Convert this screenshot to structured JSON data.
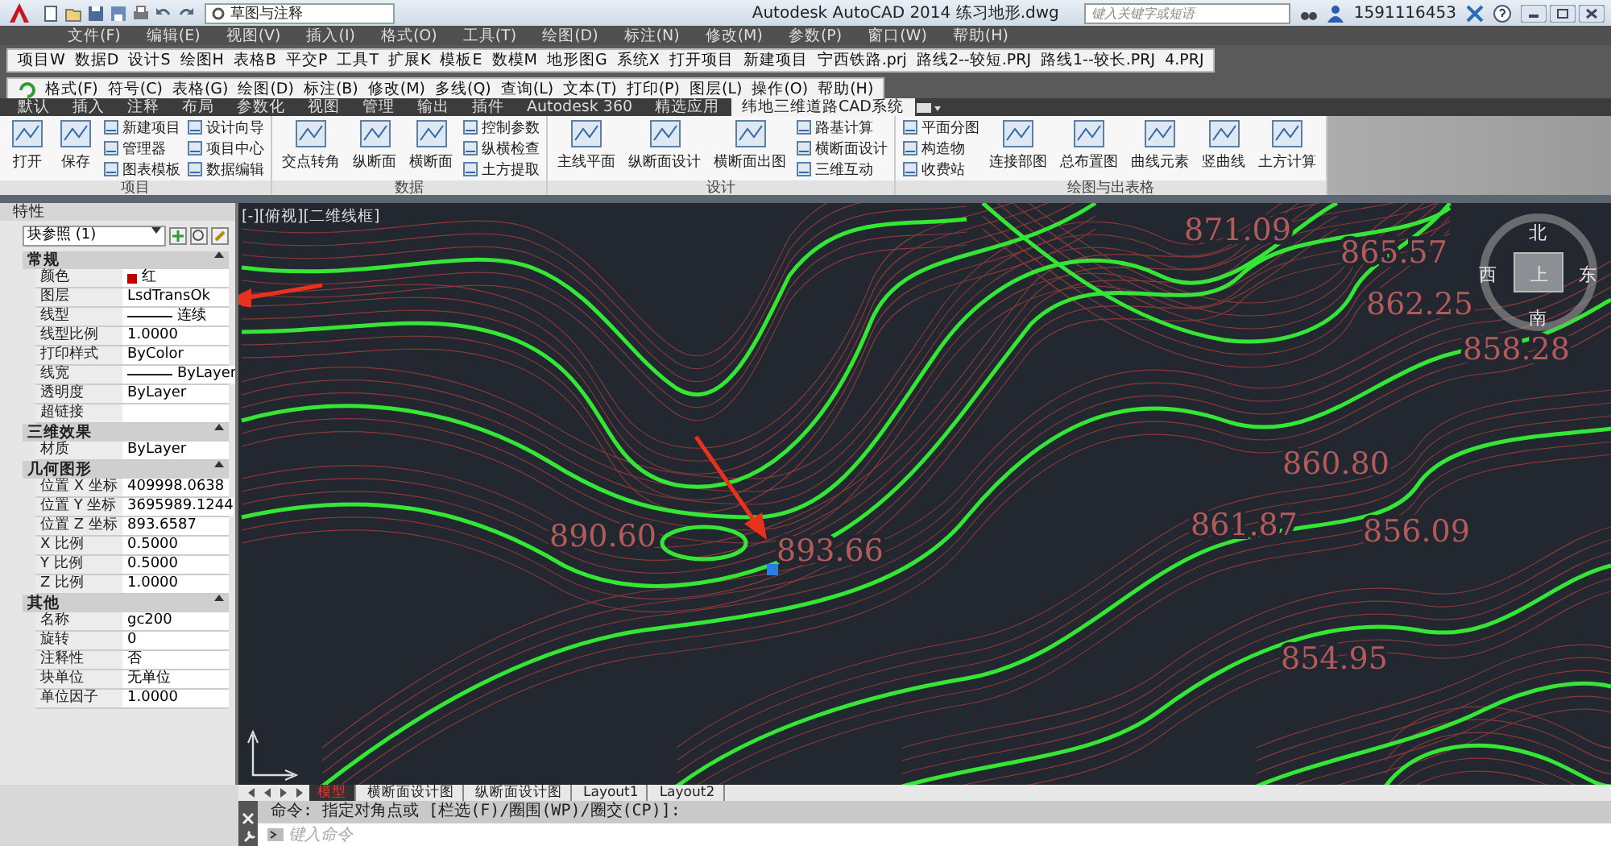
{
  "window": {
    "workspace": "草图与注释",
    "app_title": "Autodesk AutoCAD 2014",
    "file_name": "练习地形.dwg",
    "search": {
      "placeholder": "键入关键字或短语"
    },
    "user": "1591116453"
  },
  "menu_bar": [
    "文件(F)",
    "编辑(E)",
    "视图(V)",
    "插入(I)",
    "格式(O)",
    "工具(T)",
    "绘图(D)",
    "标注(N)",
    "修改(M)",
    "参数(P)",
    "窗口(W)",
    "帮助(H)"
  ],
  "toolbar_1": [
    "项目W",
    "数据D",
    "设计S",
    "绘图H",
    "表格B",
    "平交P",
    "工具T",
    "扩展K",
    "模板E",
    "数模M",
    "地形图G",
    "系统X",
    "打开项目",
    "新建项目",
    "宁西铁路.prj",
    "路线2--较短.PRJ",
    "路线1--较长.PRJ",
    "4.PRJ"
  ],
  "toolbar_2": [
    "格式(F)",
    "符号(C)",
    "表格(G)",
    "绘图(D)",
    "标注(B)",
    "修改(M)",
    "多线(Q)",
    "查询(L)",
    "文本(T)",
    "打印(P)",
    "图层(L)",
    "操作(O)",
    "帮助(H)"
  ],
  "ribbon": {
    "tabs": [
      {
        "label": "默认",
        "selected": false
      },
      {
        "label": "插入",
        "selected": false
      },
      {
        "label": "注释",
        "selected": false
      },
      {
        "label": "布局",
        "selected": false
      },
      {
        "label": "参数化",
        "selected": false
      },
      {
        "label": "视图",
        "selected": false
      },
      {
        "label": "管理",
        "selected": false
      },
      {
        "label": "输出",
        "selected": false
      },
      {
        "label": "插件",
        "selected": false
      },
      {
        "label": "Autodesk 360",
        "selected": false
      },
      {
        "label": "精选应用",
        "selected": false
      },
      {
        "label": "纬地三维道路CAD系统",
        "selected": true
      }
    ],
    "panels": [
      {
        "title": "项目",
        "tools": [
          {
            "label": "打开",
            "kind": "large"
          },
          {
            "label": "保存",
            "kind": "large"
          },
          {
            "label": "新建项目",
            "kind": "small"
          },
          {
            "label": "管理器",
            "kind": "small"
          },
          {
            "label": "图表模板",
            "kind": "small"
          },
          {
            "label": "设计向导",
            "kind": "small"
          },
          {
            "label": "项目中心",
            "kind": "small"
          },
          {
            "label": "数据编辑",
            "kind": "small"
          }
        ]
      },
      {
        "title": "数据",
        "tools": [
          {
            "label": "交点转角",
            "kind": "large"
          },
          {
            "label": "纵断面",
            "kind": "large"
          },
          {
            "label": "横断面",
            "kind": "large"
          },
          {
            "label": "控制参数",
            "kind": "small"
          },
          {
            "label": "纵横检查",
            "kind": "small"
          },
          {
            "label": "土方提取",
            "kind": "small"
          }
        ]
      },
      {
        "title": "设计",
        "tools": [
          {
            "label": "主线平面",
            "kind": "large"
          },
          {
            "label": "纵断面设计",
            "kind": "large"
          },
          {
            "label": "横断面出图",
            "kind": "large"
          },
          {
            "label": "路基计算",
            "kind": "small"
          },
          {
            "label": "横断面设计",
            "kind": "small"
          },
          {
            "label": "三维互动",
            "kind": "small"
          }
        ]
      },
      {
        "title": "绘图与出表格",
        "tools": [
          {
            "label": "平面分图",
            "kind": "small"
          },
          {
            "label": "构造物",
            "kind": "small"
          },
          {
            "label": "收费站",
            "kind": "small"
          },
          {
            "label": "连接部图",
            "kind": "large"
          },
          {
            "label": "总布置图",
            "kind": "large"
          },
          {
            "label": "曲线元素",
            "kind": "large"
          },
          {
            "label": "竖曲线",
            "kind": "large"
          },
          {
            "label": "土方计算",
            "kind": "large"
          }
        ]
      }
    ]
  },
  "properties": {
    "title": "特性",
    "selection": "块参照 (1)",
    "sections": [
      {
        "title": "常规",
        "rows": [
          {
            "name": "颜色",
            "value": "红",
            "kind": "swatch",
            "color": "#c00000"
          },
          {
            "name": "图层",
            "value": "LsdTransOk",
            "kind": "plain"
          },
          {
            "name": "线型",
            "value": "连续",
            "kind": "line"
          },
          {
            "name": "线型比例",
            "value": "1.0000",
            "kind": "plain"
          },
          {
            "name": "打印样式",
            "value": "ByColor",
            "kind": "plain"
          },
          {
            "name": "线宽",
            "value": "ByLayer",
            "kind": "line"
          },
          {
            "name": "透明度",
            "value": "ByLayer",
            "kind": "plain"
          },
          {
            "name": "超链接",
            "kind": "plain"
          }
        ]
      },
      {
        "title": "三维效果",
        "rows": [
          {
            "name": "材质",
            "value": "ByLayer",
            "kind": "plain"
          }
        ]
      },
      {
        "title": "几何图形",
        "rows": [
          {
            "name": "位置 X 坐标",
            "value": "409998.0638",
            "kind": "plain"
          },
          {
            "name": "位置 Y 坐标",
            "value": "3695989.1244",
            "kind": "plain"
          },
          {
            "name": "位置 Z 坐标",
            "value": "893.6587",
            "kind": "plain"
          },
          {
            "name": "X 比例",
            "value": "0.5000",
            "kind": "plain"
          },
          {
            "name": "Y 比例",
            "value": "0.5000",
            "kind": "plain"
          },
          {
            "name": "Z 比例",
            "value": "1.0000",
            "kind": "plain"
          }
        ]
      },
      {
        "title": "其他",
        "rows": [
          {
            "name": "名称",
            "value": "gc200",
            "kind": "plain"
          },
          {
            "name": "旋转",
            "value": "0",
            "kind": "plain"
          },
          {
            "name": "注释性",
            "value": "否",
            "kind": "plain"
          },
          {
            "name": "块单位",
            "value": "无单位",
            "kind": "plain"
          },
          {
            "name": "单位因子",
            "value": "1.0000",
            "kind": "plain"
          }
        ]
      }
    ]
  },
  "canvas": {
    "viewport_label": "[-][俯视][二维线框]",
    "elevations": [
      "871.09",
      "865.57",
      "862.25",
      "858.28",
      "860.80",
      "890.60",
      "893.66",
      "861.87",
      "856.09",
      "854.95"
    ],
    "viewcube": {
      "north": "北",
      "west": "西",
      "top": "上",
      "east": "东",
      "south": "南"
    }
  },
  "layout_tabs": [
    {
      "label": "模型",
      "selected": true
    },
    {
      "label": "横断面设计图",
      "selected": false
    },
    {
      "label": "纵断面设计图",
      "selected": false
    },
    {
      "label": "Layout1",
      "selected": false
    },
    {
      "label": "Layout2",
      "selected": false
    }
  ],
  "command": {
    "history": "命令: 指定对角点或 [栏选(F)/圈围(WP)/圈交(CP)]:",
    "placeholder": "键入命令"
  }
}
